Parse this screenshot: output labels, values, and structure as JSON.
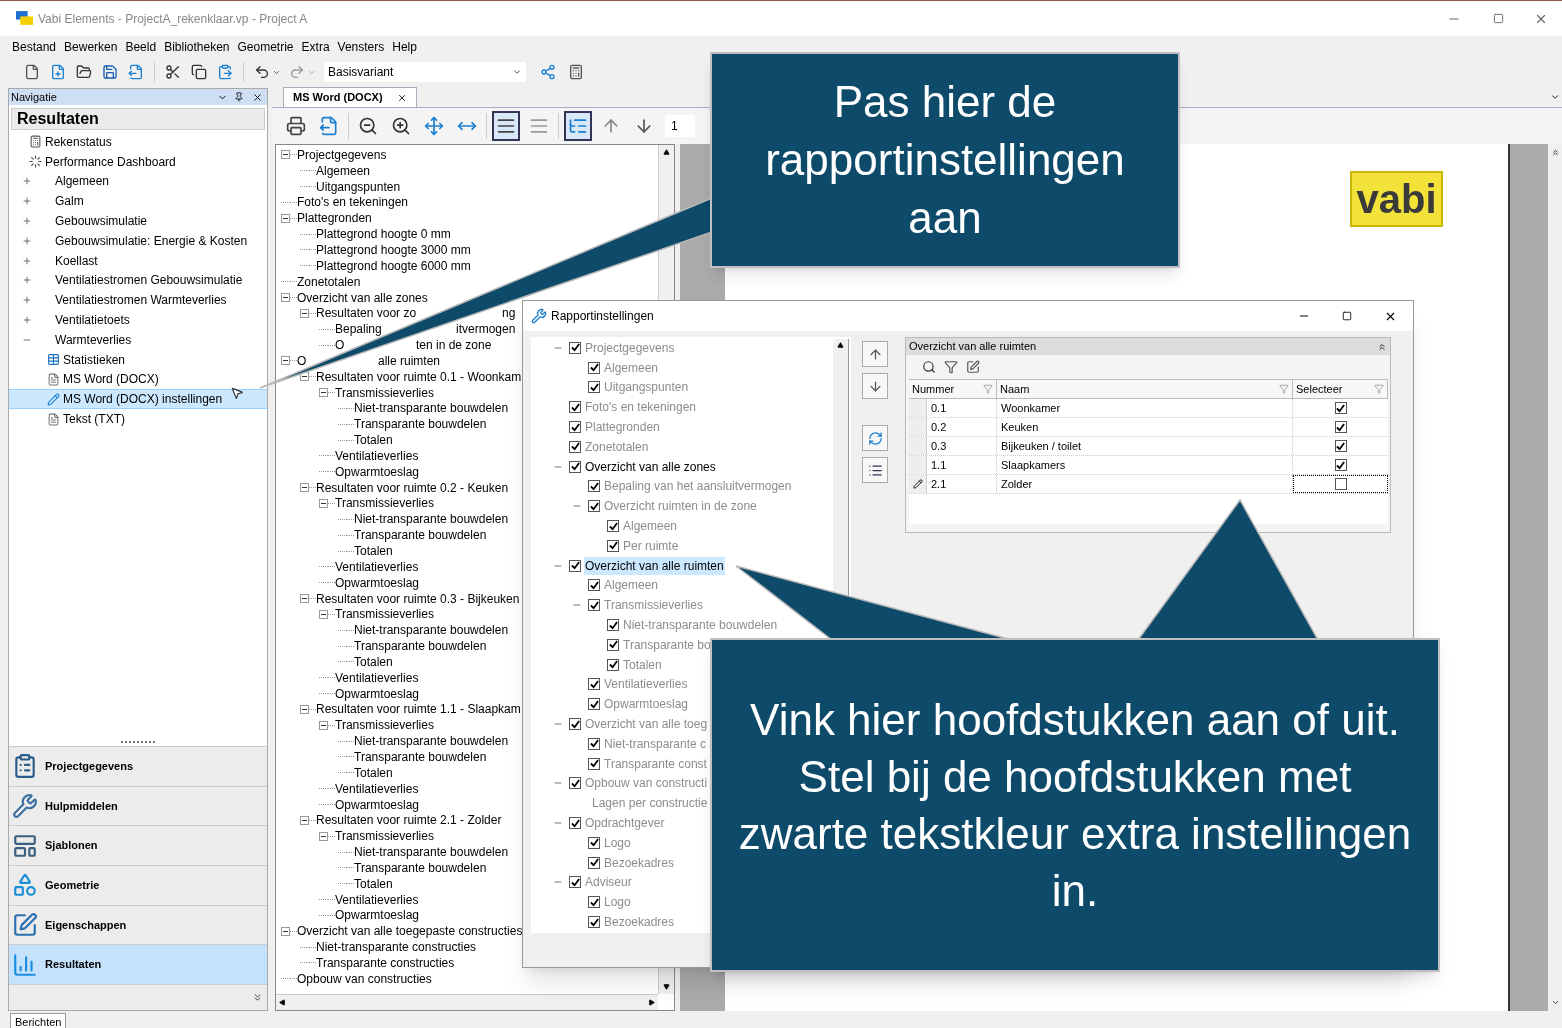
{
  "window": {
    "title": "Vabi Elements - ProjectA_rekenklaar.vp - Project A"
  },
  "menu": [
    "Bestand",
    "Bewerken",
    "Beeld",
    "Bibliotheken",
    "Geometrie",
    "Extra",
    "Vensters",
    "Help"
  ],
  "toolbar": {
    "variant": "Basisvariant"
  },
  "navigation": {
    "title": "Navigatie",
    "section": "Resultaten",
    "items": [
      {
        "label": "Rekenstatus",
        "kind": "calculator",
        "selected": false
      },
      {
        "label": "Performance Dashboard",
        "kind": "dashboard",
        "selected": false
      },
      {
        "label": "Algemeen",
        "kind": "group",
        "expanded": false,
        "selected": false
      },
      {
        "label": "Galm",
        "kind": "group",
        "expanded": false,
        "selected": false
      },
      {
        "label": "Gebouwsimulatie",
        "kind": "group",
        "expanded": false,
        "selected": false
      },
      {
        "label": "Gebouwsimulatie: Energie &  Kosten",
        "kind": "group",
        "expanded": false,
        "selected": false
      },
      {
        "label": "Koellast",
        "kind": "group",
        "expanded": false,
        "selected": false
      },
      {
        "label": "Ventilatiestromen Gebouwsimulatie",
        "kind": "group",
        "expanded": false,
        "selected": false
      },
      {
        "label": "Ventilatiestromen Warmteverlies",
        "kind": "group",
        "expanded": false,
        "selected": false
      },
      {
        "label": "Ventilatietoets",
        "kind": "group",
        "expanded": false,
        "selected": false
      },
      {
        "label": "Warmteverlies",
        "kind": "group",
        "expanded": true,
        "selected": false,
        "children": [
          {
            "label": "Statistieken",
            "kind": "table",
            "selected": false
          },
          {
            "label": "MS Word (DOCX)",
            "kind": "document",
            "selected": false
          },
          {
            "label": "MS Word (DOCX) instellingen",
            "kind": "settings",
            "selected": true
          },
          {
            "label": "Tekst (TXT)",
            "kind": "document",
            "selected": false
          }
        ]
      }
    ],
    "buttons": [
      {
        "label": "Projectgegevens",
        "kind": "project",
        "selected": false
      },
      {
        "label": "Hulpmiddelen",
        "kind": "tools",
        "selected": false
      },
      {
        "label": "Sjablonen",
        "kind": "templates",
        "selected": false
      },
      {
        "label": "Geometrie",
        "kind": "geometry",
        "selected": false
      },
      {
        "label": "Eigenschappen",
        "kind": "properties",
        "selected": false
      },
      {
        "label": "Resultaten",
        "kind": "results",
        "selected": true
      }
    ]
  },
  "document": {
    "tab": "MS Word (DOCX)",
    "page": "1",
    "logo": "vabi",
    "toolbar": [
      {
        "kind": "print",
        "pressed": false
      },
      {
        "kind": "export",
        "pressed": false
      },
      {
        "kind": "zoom-out",
        "pressed": false
      },
      {
        "kind": "zoom-in",
        "pressed": false
      },
      {
        "kind": "fit-page",
        "pressed": false
      },
      {
        "kind": "fit-width",
        "pressed": false
      },
      {
        "kind": "page-view",
        "pressed": true
      },
      {
        "kind": "text-view",
        "pressed": false
      },
      {
        "kind": "outline",
        "pressed": true
      },
      {
        "kind": "up",
        "pressed": false
      },
      {
        "kind": "down",
        "pressed": false
      }
    ],
    "outline": [
      {
        "label": "Projectgegevens",
        "children": [
          {
            "label": "Algemeen"
          },
          {
            "label": "Uitgangspunten"
          }
        ]
      },
      {
        "label": "Foto's en tekeningen"
      },
      {
        "label": "Plattegronden",
        "children": [
          {
            "label": "Plattegrond hoogte 0 mm"
          },
          {
            "label": "Plattegrond hoogte 3000 mm"
          },
          {
            "label": "Plattegrond hoogte 6000 mm"
          }
        ]
      },
      {
        "label": "Zonetotalen"
      },
      {
        "label": "Overzicht van alle zones",
        "children": [
          {
            "label": "Resultaten voor zo",
            "label_tail": "ng",
            "children": [
              {
                "label": "Bepaling",
                "label_tail": "itvermogen"
              },
              {
                "label": "O",
                "label_tail": "ten in de zone"
              }
            ]
          }
        ]
      },
      {
        "label": "O",
        "label_tail": "alle ruimten",
        "children": [
          {
            "label": "Resultaten voor ruimte 0.1 - Woonkam",
            "children": [
              {
                "label": "Transmissieverlies",
                "children": [
                  {
                    "label": "Niet-transparante bouwdelen"
                  },
                  {
                    "label": "Transparante bouwdelen"
                  },
                  {
                    "label": "Totalen"
                  }
                ]
              },
              {
                "label": "Ventilatieverlies"
              },
              {
                "label": "Opwarmtoeslag"
              }
            ]
          },
          {
            "label": "Resultaten voor ruimte 0.2 - Keuken",
            "children": [
              {
                "label": "Transmissieverlies",
                "children": [
                  {
                    "label": "Niet-transparante bouwdelen"
                  },
                  {
                    "label": "Transparante bouwdelen"
                  },
                  {
                    "label": "Totalen"
                  }
                ]
              },
              {
                "label": "Ventilatieverlies"
              },
              {
                "label": "Opwarmtoeslag"
              }
            ]
          },
          {
            "label": "Resultaten voor ruimte 0.3 - Bijkeuken",
            "children": [
              {
                "label": "Transmissieverlies",
                "children": [
                  {
                    "label": "Niet-transparante bouwdelen"
                  },
                  {
                    "label": "Transparante bouwdelen"
                  },
                  {
                    "label": "Totalen"
                  }
                ]
              },
              {
                "label": "Ventilatieverlies"
              },
              {
                "label": "Opwarmtoeslag"
              }
            ]
          },
          {
            "label": "Resultaten voor ruimte 1.1 - Slaapkam",
            "children": [
              {
                "label": "Transmissieverlies",
                "children": [
                  {
                    "label": "Niet-transparante bouwdelen"
                  },
                  {
                    "label": "Transparante bouwdelen"
                  },
                  {
                    "label": "Totalen"
                  }
                ]
              },
              {
                "label": "Ventilatieverlies"
              },
              {
                "label": "Opwarmtoeslag"
              }
            ]
          },
          {
            "label": "Resultaten voor ruimte 2.1 - Zolder",
            "children": [
              {
                "label": "Transmissieverlies",
                "children": [
                  {
                    "label": "Niet-transparante bouwdelen"
                  },
                  {
                    "label": "Transparante bouwdelen"
                  },
                  {
                    "label": "Totalen"
                  }
                ]
              },
              {
                "label": "Ventilatieverlies"
              },
              {
                "label": "Opwarmtoeslag"
              }
            ]
          }
        ]
      },
      {
        "label": "Overzicht van alle toegepaste constructies",
        "children": [
          {
            "label": "Niet-transparante constructies"
          },
          {
            "label": "Transparante constructies"
          }
        ]
      },
      {
        "label": "Opbouw van constructies"
      }
    ]
  },
  "dialog": {
    "title": "Rapportinstellingen",
    "chapters": [
      {
        "label": "Projectgegevens",
        "kind": "check",
        "checked": true,
        "settings": false,
        "selected": false,
        "children": [
          {
            "label": "Algemeen",
            "kind": "check",
            "checked": true,
            "settings": false,
            "selected": false
          },
          {
            "label": "Uitgangspunten",
            "kind": "check",
            "checked": true,
            "settings": false,
            "selected": false
          }
        ]
      },
      {
        "label": "Foto's en tekeningen",
        "kind": "check",
        "checked": true,
        "settings": false,
        "selected": false
      },
      {
        "label": "Plattegronden",
        "kind": "check",
        "checked": true,
        "settings": false,
        "selected": false
      },
      {
        "label": "Zonetotalen",
        "kind": "check",
        "checked": true,
        "settings": false,
        "selected": false
      },
      {
        "label": "Overzicht van alle zones",
        "kind": "check",
        "checked": true,
        "settings": true,
        "selected": false,
        "children": [
          {
            "label": "Bepaling van het aansluitvermogen",
            "kind": "check",
            "checked": true,
            "settings": false,
            "selected": false
          },
          {
            "label": "Overzicht ruimten in de zone",
            "kind": "check",
            "checked": true,
            "settings": false,
            "selected": false,
            "children": [
              {
                "label": "Algemeen",
                "kind": "check",
                "checked": true,
                "settings": false,
                "selected": false
              },
              {
                "label": "Per ruimte",
                "kind": "check",
                "checked": true,
                "settings": false,
                "selected": false
              }
            ]
          }
        ]
      },
      {
        "label": "Overzicht van alle ruimten",
        "kind": "check",
        "checked": true,
        "settings": true,
        "selected": true,
        "children": [
          {
            "label": "Algemeen",
            "kind": "check",
            "checked": true,
            "settings": false,
            "selected": false
          },
          {
            "label": "Transmissieverlies",
            "kind": "check",
            "checked": true,
            "settings": false,
            "selected": false,
            "children": [
              {
                "label": "Niet-transparante bouwdelen",
                "kind": "check",
                "checked": true,
                "settings": false,
                "selected": false
              },
              {
                "label": "Transparante bo",
                "kind": "check",
                "checked": true,
                "settings": false,
                "selected": false
              },
              {
                "label": "Totalen",
                "kind": "check",
                "checked": true,
                "settings": false,
                "selected": false
              }
            ]
          },
          {
            "label": "Ventilatieverlies",
            "kind": "check",
            "checked": true,
            "settings": false,
            "selected": false
          },
          {
            "label": "Opwarmtoeslag",
            "kind": "check",
            "checked": true,
            "settings": false,
            "selected": false
          }
        ]
      },
      {
        "label": "Overzicht van alle toeg",
        "kind": "check",
        "checked": true,
        "settings": false,
        "selected": false,
        "children": [
          {
            "label": "Niet-transparante c",
            "kind": "check",
            "checked": true,
            "settings": false,
            "selected": false
          },
          {
            "label": "Transparante const",
            "kind": "check",
            "checked": true,
            "settings": false,
            "selected": false
          }
        ]
      },
      {
        "label": "Opbouw van constructi",
        "kind": "check",
        "checked": true,
        "settings": false,
        "selected": false,
        "children": [
          {
            "label": "Lagen per constructie",
            "kind": "label",
            "settings": false,
            "selected": false
          }
        ]
      },
      {
        "label": "Opdrachtgever",
        "kind": "check",
        "checked": true,
        "settings": false,
        "selected": false,
        "children": [
          {
            "label": "Logo",
            "kind": "check",
            "checked": true,
            "settings": false,
            "selected": false
          },
          {
            "label": "Bezoekadres",
            "kind": "check",
            "checked": true,
            "settings": false,
            "selected": false
          }
        ]
      },
      {
        "label": "Adviseur",
        "kind": "check",
        "checked": true,
        "settings": false,
        "selected": false,
        "children": [
          {
            "label": "Logo",
            "kind": "check",
            "checked": true,
            "settings": false,
            "selected": false
          },
          {
            "label": "Bezoekadres",
            "kind": "check",
            "checked": true,
            "settings": false,
            "selected": false
          }
        ]
      }
    ],
    "grid": {
      "title": "Overzicht van alle ruimten",
      "columns": [
        "Nummer",
        "Naam",
        "Selecteer"
      ],
      "rows": [
        {
          "number": "0.1",
          "name": "Woonkamer",
          "checked": true,
          "current": false
        },
        {
          "number": "0.2",
          "name": "Keuken",
          "checked": true,
          "current": false
        },
        {
          "number": "0.3",
          "name": "Bijkeuken / toilet",
          "checked": true,
          "current": false
        },
        {
          "number": "1.1",
          "name": "Slaapkamers",
          "checked": true,
          "current": false
        },
        {
          "number": "2.1",
          "name": "Zolder",
          "checked": false,
          "current": true
        }
      ]
    }
  },
  "callouts": [
    {
      "text": "Pas hier de rapportinstellingen aan"
    },
    {
      "text": "Vink hier hoofdstukken aan of uit. Stel bij de hoofdstukken met zwarte tekstkleur extra instellingen in."
    }
  ],
  "status_bar": {
    "tab": "Berichten"
  }
}
